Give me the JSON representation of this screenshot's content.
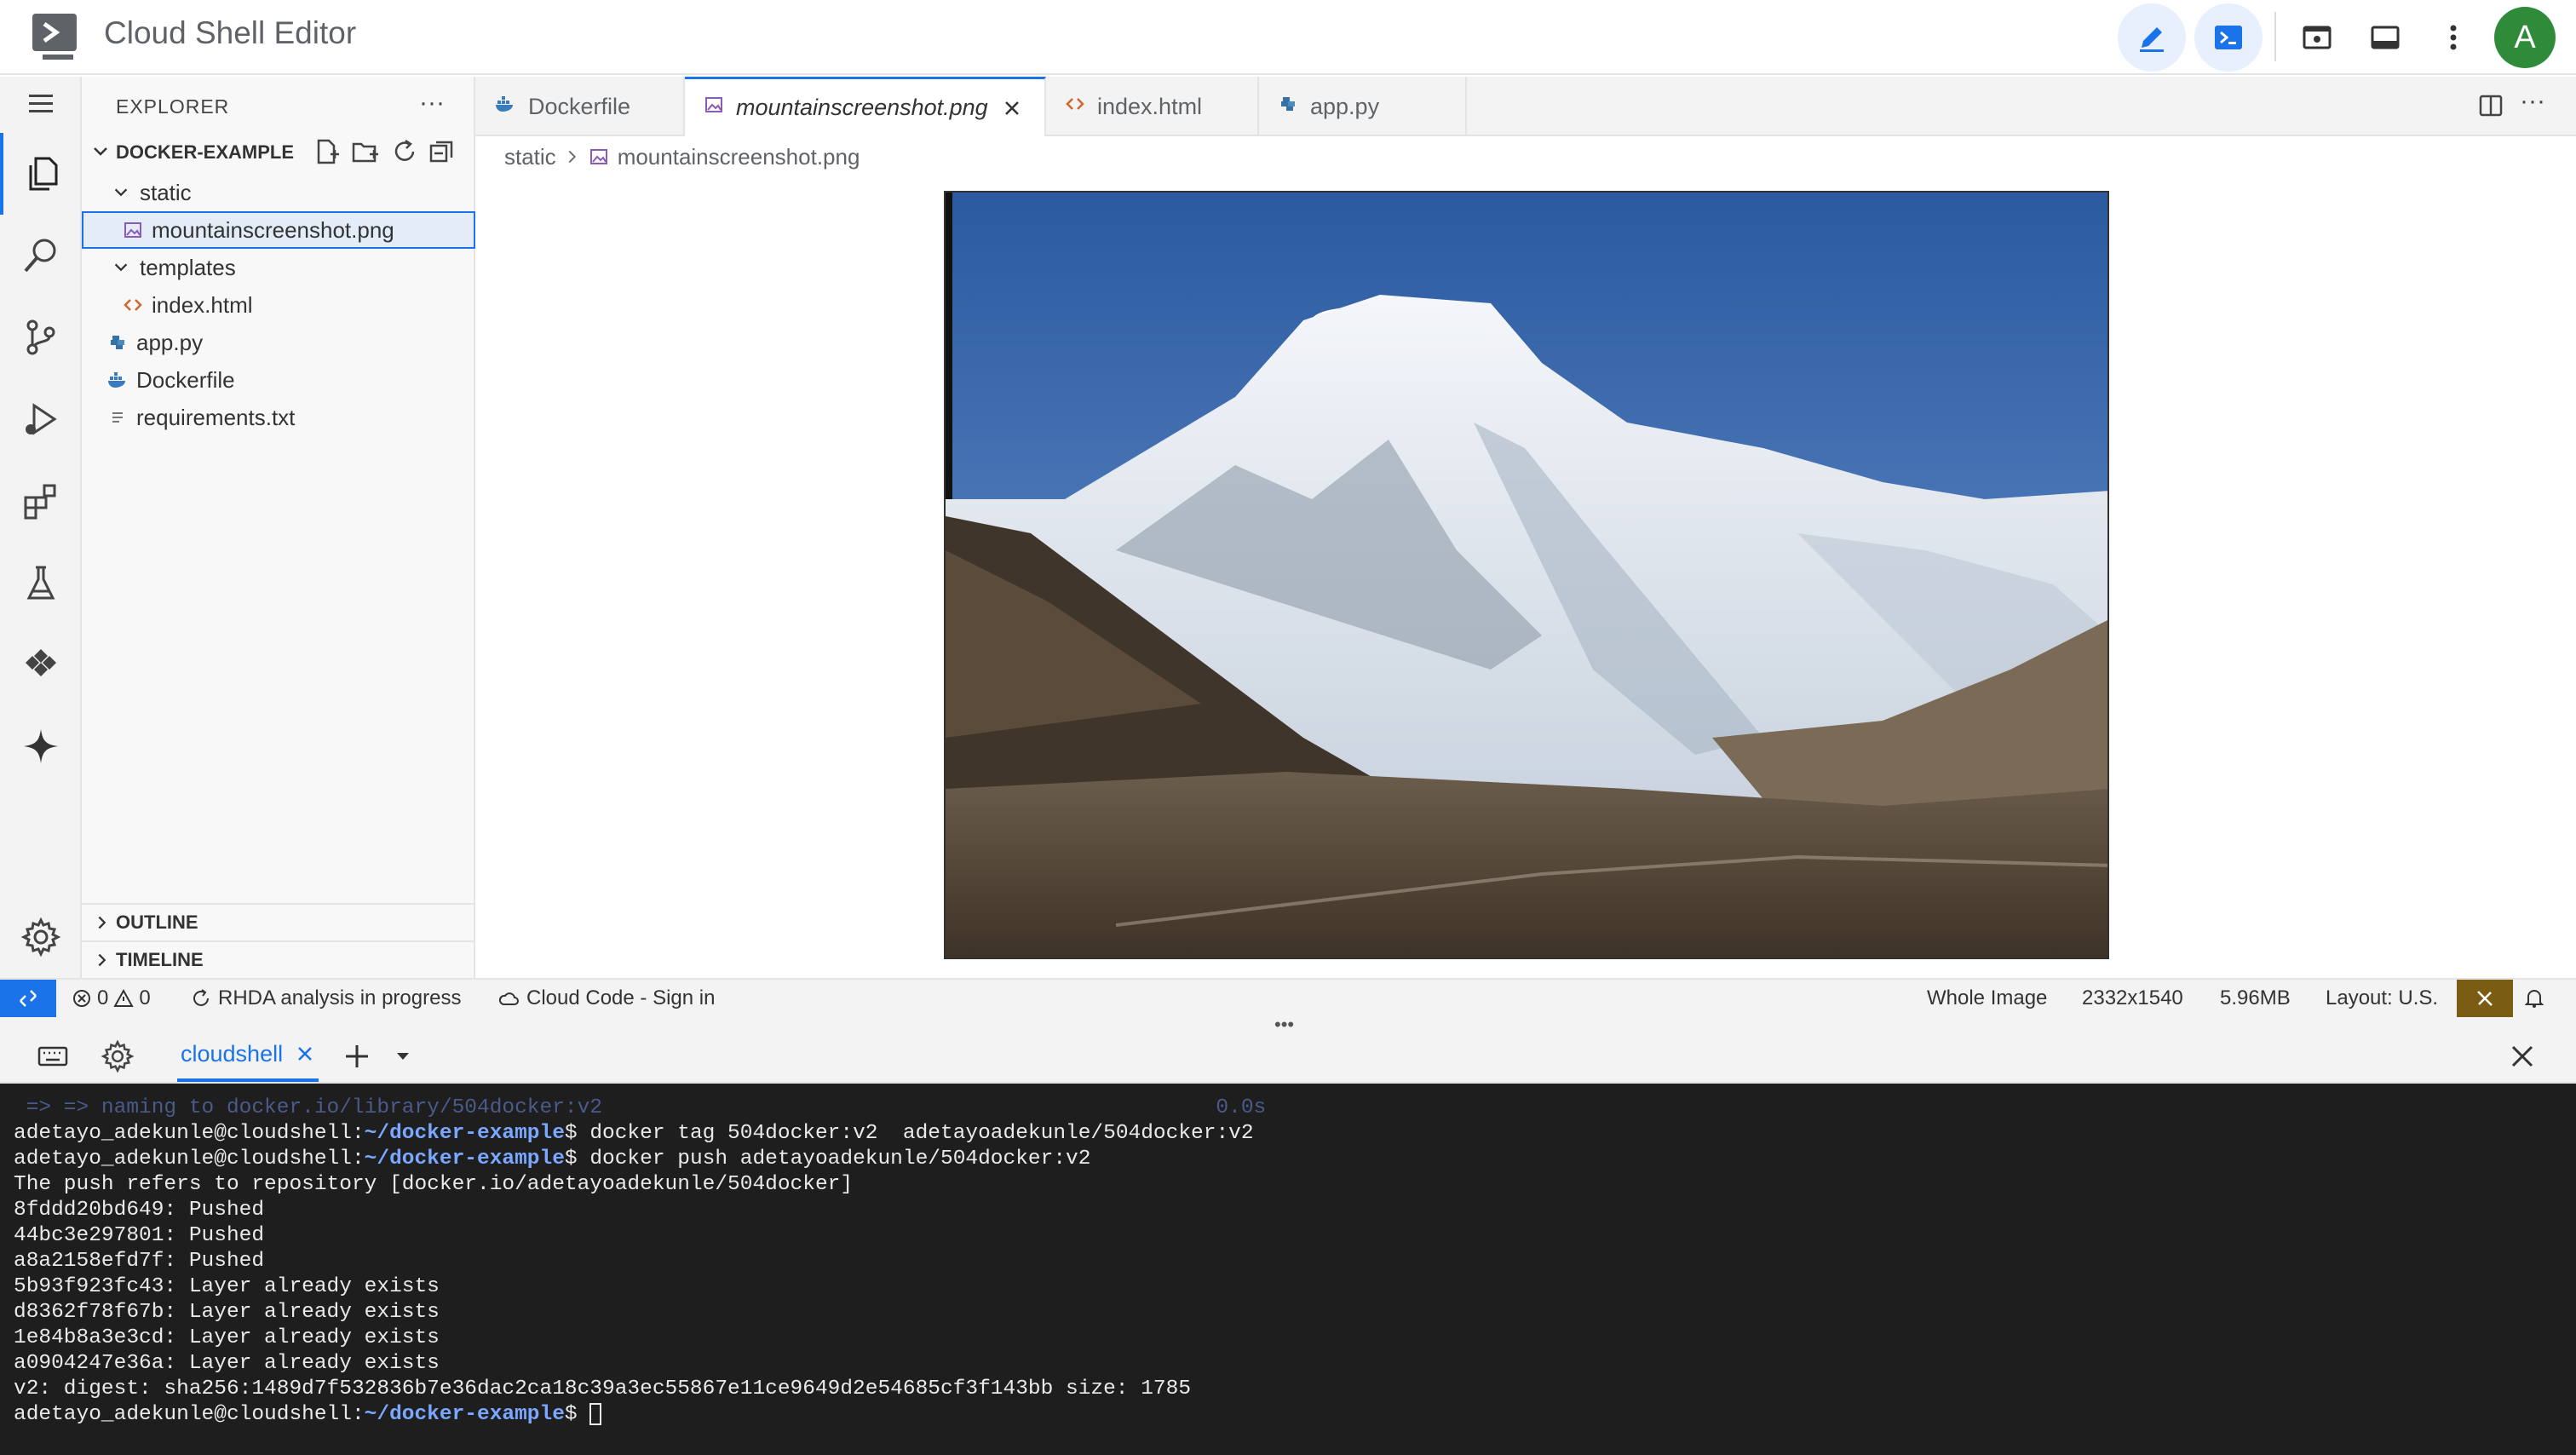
{
  "app": {
    "title": "Cloud Shell Editor",
    "avatar_letter": "A"
  },
  "explorer": {
    "title": "EXPLORER",
    "project": "DOCKER-EXAMPLE",
    "tree": [
      {
        "label": "static",
        "kind": "folder"
      },
      {
        "label": "mountainscreenshot.png",
        "kind": "image"
      },
      {
        "label": "templates",
        "kind": "folder"
      },
      {
        "label": "index.html",
        "kind": "html"
      },
      {
        "label": "app.py",
        "kind": "python"
      },
      {
        "label": "Dockerfile",
        "kind": "docker"
      },
      {
        "label": "requirements.txt",
        "kind": "text"
      }
    ],
    "sections": [
      "OUTLINE",
      "TIMELINE"
    ]
  },
  "tabs": [
    {
      "label": "Dockerfile",
      "icon": "docker-icon"
    },
    {
      "label": "mountainscreenshot.png",
      "icon": "image-icon",
      "active": true
    },
    {
      "label": "index.html",
      "icon": "code-icon"
    },
    {
      "label": "app.py",
      "icon": "python-icon"
    }
  ],
  "breadcrumb": {
    "folder": "static",
    "file": "mountainscreenshot.png"
  },
  "statusbar": {
    "errors": "0",
    "warnings": "0",
    "rhda": "RHDA analysis in progress",
    "cloud_code": "Cloud Code - Sign in",
    "whole_image": "Whole Image",
    "dimensions": "2332x1540",
    "size": "5.96MB",
    "layout": "Layout: U.S."
  },
  "panel": {
    "tab": "cloudshell"
  },
  "terminal": {
    "lines": [
      {
        "text": " => => naming to docker.io/library/504docker:v2                                                 0.0s",
        "dim": true
      },
      {
        "user": "adetayo_adekunle@cloudshell:",
        "path": "~/docker-example",
        "cmd": "$ docker tag 504docker:v2  adetayoadekunle/504docker:v2"
      },
      {
        "user": "adetayo_adekunle@cloudshell:",
        "path": "~/docker-example",
        "cmd": "$ docker push adetayoadekunle/504docker:v2"
      },
      {
        "text": "The push refers to repository [docker.io/adetayoadekunle/504docker]"
      },
      {
        "text": "8fddd20bd649: Pushed"
      },
      {
        "text": "44bc3e297801: Pushed"
      },
      {
        "text": "a8a2158efd7f: Pushed"
      },
      {
        "text": "5b93f923fc43: Layer already exists"
      },
      {
        "text": "d8362f78f67b: Layer already exists"
      },
      {
        "text": "1e84b8a3e3cd: Layer already exists"
      },
      {
        "text": "a0904247e36a: Layer already exists"
      },
      {
        "text": "v2: digest: sha256:1489d7f532836b7e36dac2ca18c39a3ec55867e11ce9649d2e54685cf3f143bb size: 1785"
      },
      {
        "user": "adetayo_adekunle@cloudshell:",
        "path": "~/docker-example",
        "cmd": "$ ",
        "cursor": true
      }
    ]
  },
  "colors": {
    "accent": "#1a73e8",
    "terminal_bg": "#1e1e1e",
    "path": "#7aa7ff"
  }
}
